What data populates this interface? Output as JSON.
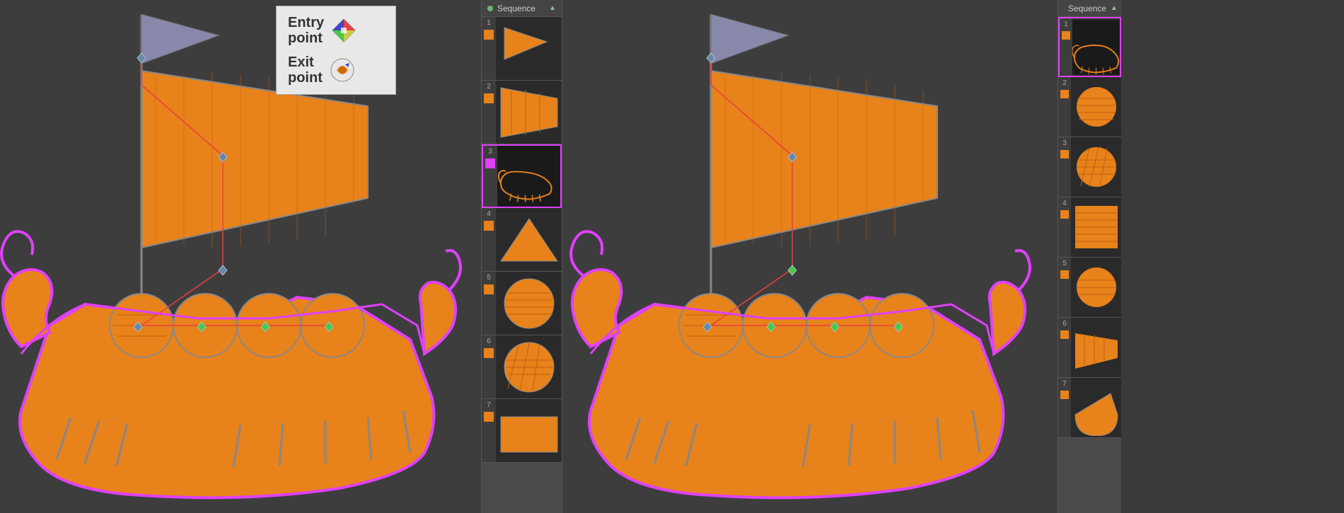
{
  "panels": [
    {
      "id": "left-canvas",
      "type": "canvas"
    },
    {
      "id": "left-sequence",
      "label": "Sequence",
      "items": [
        {
          "num": 1,
          "active": false
        },
        {
          "num": 2,
          "active": false
        },
        {
          "num": 3,
          "active": true
        },
        {
          "num": 4,
          "active": false
        },
        {
          "num": 5,
          "active": false
        },
        {
          "num": 6,
          "active": false
        },
        {
          "num": 7,
          "active": false
        }
      ]
    },
    {
      "id": "right-canvas",
      "type": "canvas"
    },
    {
      "id": "right-sequence",
      "label": "Sequence",
      "items": [
        {
          "num": 1,
          "active": true
        },
        {
          "num": 2,
          "active": false
        },
        {
          "num": 3,
          "active": false
        },
        {
          "num": 4,
          "active": false
        },
        {
          "num": 5,
          "active": false
        },
        {
          "num": 6,
          "active": false
        },
        {
          "num": 7,
          "active": false
        }
      ]
    }
  ],
  "popup": {
    "entry_label": "Entry\npoint",
    "exit_label": "Exit\npoint"
  },
  "colors": {
    "accent_pink": "#e040fb",
    "orange": "#e8821a",
    "green": "#6db56d",
    "red": "#e84040",
    "bg_dark": "#3a3a3a",
    "bg_mid": "#4a4a4a",
    "bg_light": "#e8e8e8"
  }
}
